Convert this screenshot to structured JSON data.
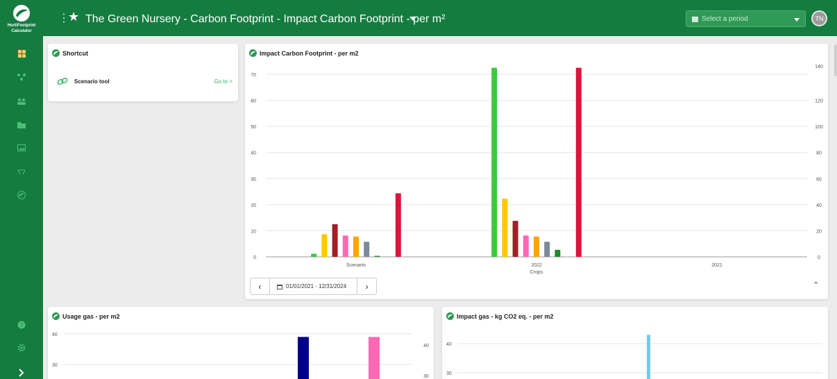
{
  "app": {
    "logo_text_1": "HortiFootprint",
    "logo_text_2": "Calculator"
  },
  "header": {
    "title": "The Green Nursery - Carbon Footprint - Impact Carbon Footprint - per m²",
    "period_placeholder": "Select a period",
    "avatar_initials": "TN"
  },
  "sidebar": {
    "items": [
      {
        "icon": "dashboard-icon"
      },
      {
        "icon": "network-icon"
      },
      {
        "icon": "users-icon"
      },
      {
        "icon": "folder-icon"
      },
      {
        "icon": "image-icon"
      },
      {
        "icon": "scale-icon"
      },
      {
        "icon": "footprint-logo-icon"
      }
    ],
    "bottom": [
      {
        "icon": "help-icon"
      },
      {
        "icon": "settings-icon"
      },
      {
        "icon": "expand-icon"
      }
    ]
  },
  "shortcut": {
    "title": "Shortcut",
    "item_label": "Scenario tool",
    "goto_label": "Go to >"
  },
  "main_chart": {
    "title": "Impact Carbon Footprint - per m2",
    "date_range": "01/01/2021 - 12/31/2024"
  },
  "usage_gas": {
    "title": "Usage gas - per m2"
  },
  "impact_gas": {
    "title": "Impact gas - kg CO2 eq. - per m2"
  },
  "colors": {
    "brand": "#157c40",
    "accent": "#2eb35a"
  },
  "chart_data": [
    {
      "type": "bar",
      "title": "Impact Carbon Footprint - per m2",
      "xlabel": "Crops",
      "categories": [
        "Scenario",
        "2022",
        "2021"
      ],
      "ylim": [
        0,
        70
      ],
      "yticks": [
        0,
        10,
        20,
        30,
        40,
        50,
        60,
        70
      ],
      "y2lim": [
        0,
        140
      ],
      "y2ticks": [
        0,
        20,
        40,
        60,
        80,
        100,
        120,
        140
      ],
      "series": [
        {
          "color": "#3ec83e",
          "values": [
            1.2,
            72.5,
            0
          ]
        },
        {
          "color": "#ffc800",
          "values": [
            8.7,
            22.3,
            0
          ]
        },
        {
          "color": "#a02028",
          "values": [
            12.5,
            13.8,
            0
          ]
        },
        {
          "color": "#ff69b4",
          "values": [
            8.2,
            8.2,
            0
          ]
        },
        {
          "color": "#ffa500",
          "values": [
            7.8,
            7.8,
            0
          ]
        },
        {
          "color": "#7b8a9a",
          "values": [
            5.8,
            5.8,
            0
          ]
        },
        {
          "color": "#1f8a2a",
          "values": [
            0.4,
            2.7,
            0
          ]
        },
        {
          "color": "#b8c8b8",
          "values": [
            0,
            0.2,
            0
          ]
        },
        {
          "color": "#dc143c",
          "values": [
            24.4,
            72.5,
            0
          ]
        }
      ]
    },
    {
      "type": "bar",
      "title": "Usage gas - per m2",
      "yticks": [
        30,
        40
      ],
      "y2ticks": [
        30,
        40
      ],
      "series": [
        {
          "color": "#00008b",
          "values": [
            39
          ]
        },
        {
          "color": "#ff69b4",
          "values": [
            39
          ]
        }
      ]
    },
    {
      "type": "bar",
      "title": "Impact gas - kg CO2 eq. - per m2",
      "yticks": [
        30,
        40
      ],
      "series": [
        {
          "color": "#6ecbf5",
          "values": [
            43
          ]
        }
      ]
    }
  ]
}
